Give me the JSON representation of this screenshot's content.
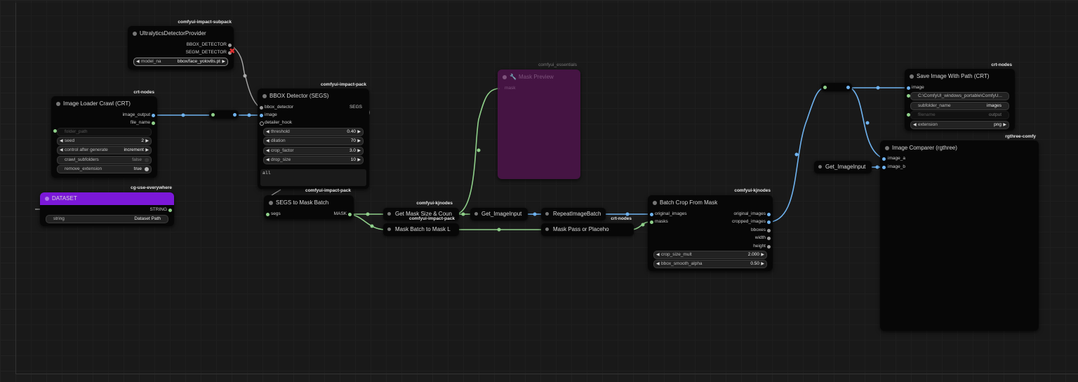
{
  "group": {
    "title": ""
  },
  "nodes": {
    "ultralytics": {
      "pack": "comfyui-impact-subpack",
      "title": "UltralyticsDetectorProvider",
      "outputs": [
        "BBOX_DETECTOR",
        "SEGM_DETECTOR"
      ],
      "model_label": "model_na",
      "model_value": "bbox/face_yolov8s.pt"
    },
    "image_loader": {
      "pack": "crt-nodes",
      "title": "Image Loader Crawl (CRT)",
      "outputs": [
        "image_output",
        "file_name"
      ],
      "folder_placeholder": "folder_path",
      "widgets": [
        {
          "label": "seed",
          "value": "2"
        },
        {
          "label": "control after generate",
          "value": "increment"
        },
        {
          "label": "crawl_subfolders",
          "value": "false"
        },
        {
          "label": "remove_extension",
          "value": "true"
        }
      ]
    },
    "dataset": {
      "pack": "cg-use-everywhere",
      "title": "DATASET",
      "output": "STRING",
      "widget_label": "string",
      "widget_value": "Dataset Path"
    },
    "bbox_detector": {
      "pack": "comfyui-impact-pack",
      "title": "BBOX Detector (SEGS)",
      "inputs": [
        "bbox_detector",
        "image",
        "detailer_hook"
      ],
      "output": "SEGS",
      "widgets": [
        {
          "label": "threshold",
          "value": "0.40"
        },
        {
          "label": "dilation",
          "value": "70"
        },
        {
          "label": "crop_factor",
          "value": "3.0"
        },
        {
          "label": "drop_size",
          "value": "10"
        }
      ],
      "text": "all"
    },
    "segs_to_mask": {
      "pack": "comfyui-impact-pack",
      "title": "SEGS to Mask Batch",
      "input": "segs",
      "output": "MASK"
    },
    "mask_preview": {
      "pack": "comfyui_essentials",
      "title": "Mask Preview",
      "input": "mask"
    },
    "get_mask_size": {
      "pack": "comfyui-kjnodes",
      "title": "Get Mask Size & Coun"
    },
    "mask_batch_to_list": {
      "pack": "comfyui-impact-pack",
      "title": "Mask Batch to Mask L"
    },
    "get_imageinput_mid": {
      "title": "Get_ImageInput"
    },
    "repeat_image_batch": {
      "title": "RepeatImageBatch"
    },
    "mask_pass": {
      "pack": "crt-nodes",
      "title": "Mask Pass or Placeho"
    },
    "batch_crop": {
      "pack": "comfyui-kjnodes",
      "title": "Batch Crop From Mask",
      "inputs": [
        "original_images",
        "masks"
      ],
      "outputs": [
        "original_images",
        "cropped_images",
        "bboxes",
        "width",
        "height"
      ],
      "widgets": [
        {
          "label": "crop_size_mult",
          "value": "2.000"
        },
        {
          "label": "bbox_smooth_alpha",
          "value": "0.50"
        }
      ]
    },
    "save_image": {
      "pack": "crt-nodes",
      "title": "Save Image With Path (CRT)",
      "input": "image",
      "widgets": [
        {
          "label": "",
          "value": "C:\\ComfyUI_windows_portable\\ComfyU..."
        },
        {
          "label": "subfolder_name",
          "value": "images"
        },
        {
          "label": "filename",
          "value": "output"
        },
        {
          "label": "extension",
          "value": "png"
        }
      ]
    },
    "image_comparer": {
      "pack": "rgthree-comfy",
      "title": "Image Comparer (rgthree)",
      "inputs": [
        "image_a",
        "image_b"
      ]
    },
    "get_imageinput_right": {
      "title": "Get_ImageInput"
    }
  },
  "colors": {
    "image_link": "#6fb3f0",
    "mask_link": "#8fd08a",
    "detector_link": "#aaaaaa",
    "dataset_header": "#7b18d8",
    "bypassed_node": "#4a1448"
  }
}
